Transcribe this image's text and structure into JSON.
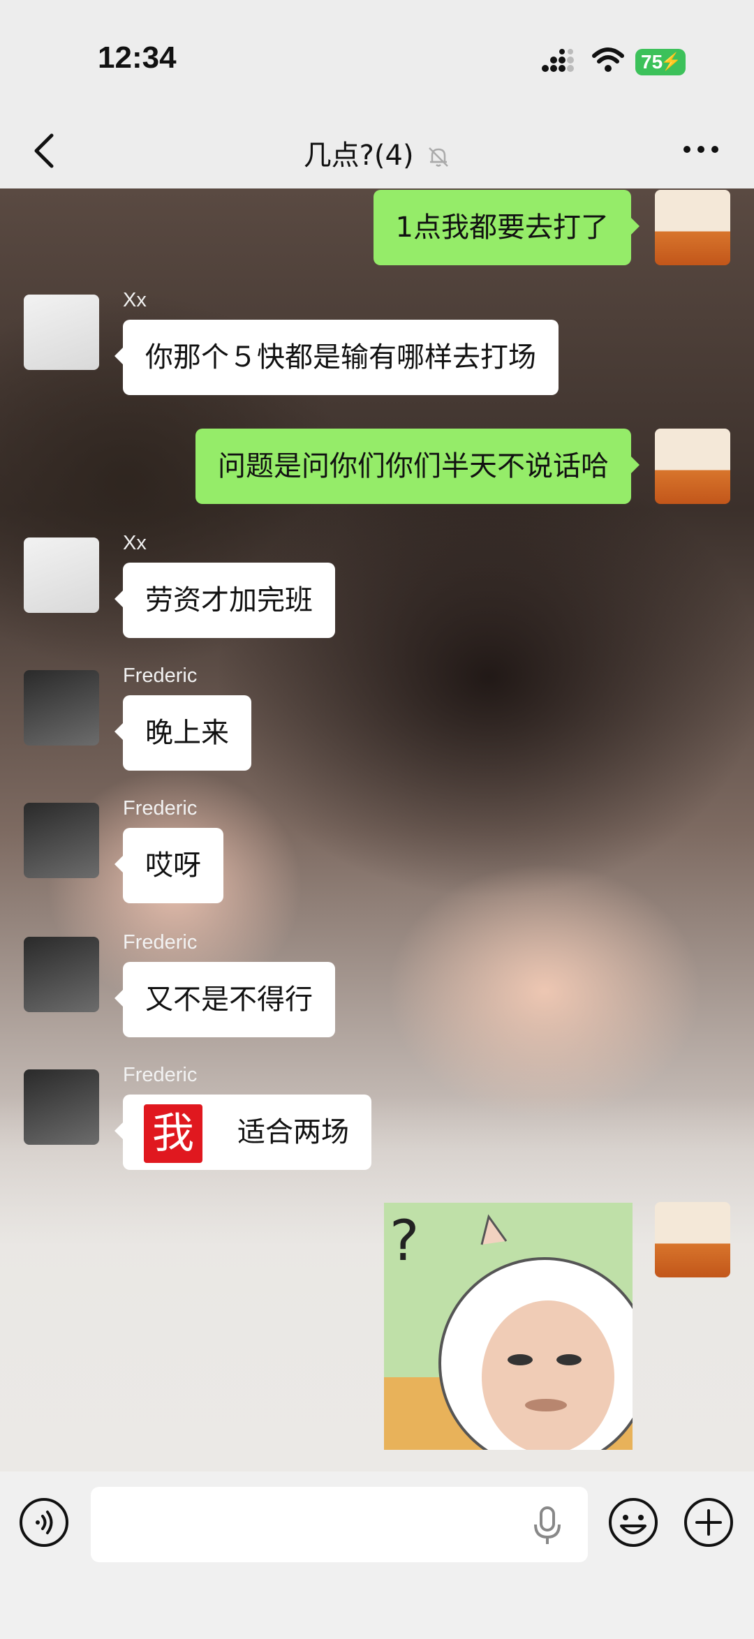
{
  "status_bar": {
    "time": "12:34",
    "battery": "75"
  },
  "header": {
    "title": "几点?(4)"
  },
  "messages": [
    {
      "side": "right",
      "text": "1点我都要去打了"
    },
    {
      "side": "left",
      "sender": "Xx",
      "text": "你那个５快都是输有哪样去打场"
    },
    {
      "side": "right",
      "text": "问题是问你们你们半天不说话哈"
    },
    {
      "side": "left",
      "sender": "Xx",
      "text": "劳资才加完班"
    },
    {
      "side": "left",
      "sender": "Frederic",
      "text": "晚上来"
    },
    {
      "side": "left",
      "sender": "Frederic",
      "text": "哎呀"
    },
    {
      "side": "left",
      "sender": "Frederic",
      "text": "又不是不得行"
    },
    {
      "side": "left",
      "sender": "Frederic",
      "sticker": "我",
      "text": "适合两场"
    },
    {
      "side": "right",
      "image": "meme-sheep-sticker"
    }
  ],
  "input_bar": {
    "placeholder": ""
  },
  "icons": {
    "back": "chevron-left-icon",
    "mute": "bell-muted-icon",
    "more": "more-dots-icon",
    "voice": "voice-mode-icon",
    "mic": "microphone-icon",
    "emoji": "emoji-icon",
    "plus": "plus-icon"
  },
  "colors": {
    "sent_bubble": "#95ec69",
    "received_bubble": "#ffffff",
    "sticker_red": "#e0181f"
  }
}
